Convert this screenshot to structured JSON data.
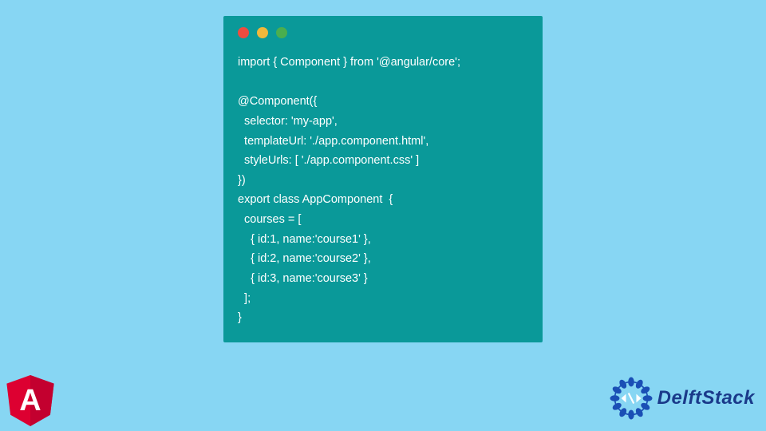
{
  "code": {
    "lines": [
      "import { Component } from '@angular/core';",
      "",
      "@Component({",
      "  selector: 'my-app',",
      "  templateUrl: './app.component.html',",
      "  styleUrls: [ './app.component.css' ]",
      "})",
      "export class AppComponent  {",
      "  courses = [",
      "    { id:1, name:'course1' },",
      "    { id:2, name:'course2' },",
      "    { id:3, name:'course3' }",
      "  ];",
      "}"
    ]
  },
  "brand": {
    "name": "DelftStack"
  },
  "logos": {
    "angular_letter": "A"
  }
}
